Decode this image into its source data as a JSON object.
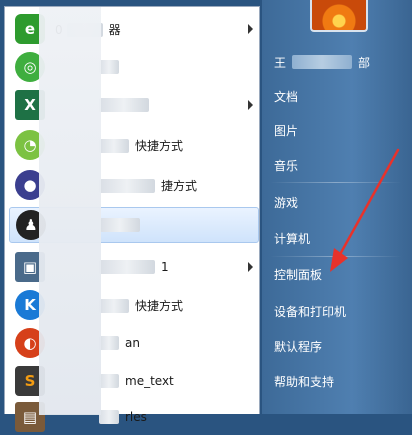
{
  "programs": {
    "items": [
      {
        "label_tail": "0",
        "label_rest": "器",
        "icon": "ie-icon",
        "icon_color": "#2e9b2e",
        "icon_glyph": "e",
        "has_submenu": true
      },
      {
        "label_tail": "",
        "label_rest": "",
        "icon": "wechat-icon",
        "icon_color": "#3fae3f",
        "icon_glyph": "◎",
        "has_submenu": false
      },
      {
        "label_tail": "",
        "label_rest": "",
        "icon": "excel-icon",
        "icon_color": "#1e7145",
        "icon_glyph": "X",
        "has_submenu": true
      },
      {
        "label_tail": "",
        "label_rest": "快捷方式",
        "icon": "green-app-icon",
        "icon_color": "#7cc242",
        "icon_glyph": "◔",
        "has_submenu": false
      },
      {
        "label_tail": "",
        "label_rest": "捷方式",
        "icon": "eclipse-icon",
        "icon_color": "#3b3f8f",
        "icon_glyph": "●",
        "has_submenu": false
      },
      {
        "label_tail": "",
        "label_rest": "",
        "icon": "qq-icon",
        "icon_color": "#222222",
        "icon_glyph": "♟",
        "has_submenu": false
      },
      {
        "label_tail": "",
        "label_rest": "1",
        "icon": "window-app-icon",
        "icon_color": "#4a6a8a",
        "icon_glyph": "▣",
        "has_submenu": true
      },
      {
        "label_tail": "",
        "label_rest": "快捷方式",
        "icon": "kugou-icon",
        "icon_color": "#1a7ad6",
        "icon_glyph": "K",
        "has_submenu": false
      },
      {
        "label_tail": "",
        "label_rest": "an",
        "icon": "red-app-icon",
        "icon_color": "#d6401a",
        "icon_glyph": "◐",
        "has_submenu": false
      },
      {
        "label_tail": "",
        "label_rest": "me_text",
        "icon": "sublime-icon",
        "icon_color": "#3a3a3a",
        "icon_glyph": "S",
        "has_submenu": false
      },
      {
        "label_tail": "",
        "label_rest": "rles",
        "icon": "generic-app-icon",
        "icon_color": "#7a5a3a",
        "icon_glyph": "▤",
        "has_submenu": false
      }
    ]
  },
  "places": {
    "user_name_start": "王",
    "user_name_end": "部",
    "items": [
      "文档",
      "图片",
      "音乐",
      "游戏",
      "计算机",
      "控制面板",
      "设备和打印机",
      "默认程序",
      "帮助和支持"
    ]
  },
  "colors": {
    "annotation": "#e8322b",
    "places_bg": "#4f7fb0"
  }
}
